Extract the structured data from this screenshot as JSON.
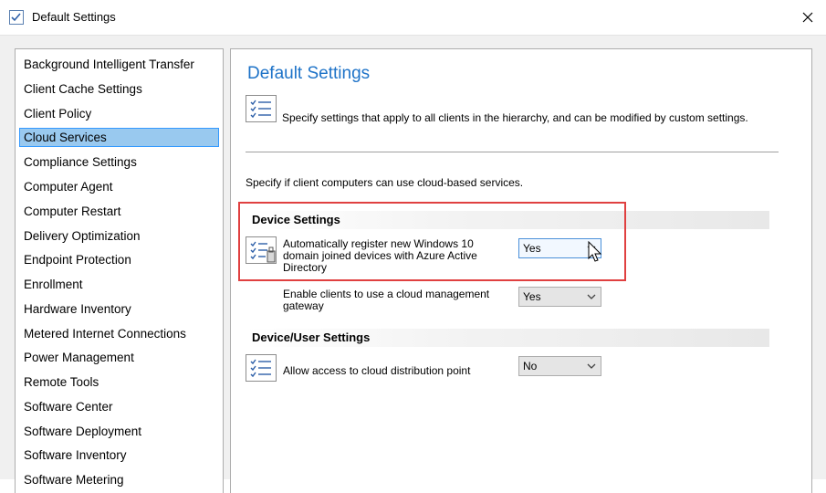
{
  "window": {
    "title": "Default Settings",
    "close_label": "✕"
  },
  "sidebar": {
    "items": [
      {
        "label": "Background Intelligent Transfer"
      },
      {
        "label": "Client Cache Settings"
      },
      {
        "label": "Client Policy"
      },
      {
        "label": "Cloud Services",
        "selected": true
      },
      {
        "label": "Compliance Settings"
      },
      {
        "label": "Computer Agent"
      },
      {
        "label": "Computer Restart"
      },
      {
        "label": "Delivery Optimization"
      },
      {
        "label": "Endpoint Protection"
      },
      {
        "label": "Enrollment"
      },
      {
        "label": "Hardware Inventory"
      },
      {
        "label": "Metered Internet Connections"
      },
      {
        "label": "Power Management"
      },
      {
        "label": "Remote Tools"
      },
      {
        "label": "Software Center"
      },
      {
        "label": "Software Deployment"
      },
      {
        "label": "Software Inventory"
      },
      {
        "label": "Software Metering"
      }
    ]
  },
  "main": {
    "title": "Default Settings",
    "description": "Specify settings that apply to all clients in the hierarchy, and can be modified by custom settings.",
    "intro": "Specify if client computers can use cloud-based services.",
    "sections": [
      {
        "title": "Device Settings",
        "settings": [
          {
            "label": "Automatically register new Windows 10 domain joined devices with Azure Active Directory",
            "value": "Yes"
          },
          {
            "label": "Enable clients to use a cloud management gateway",
            "value": "Yes"
          }
        ]
      },
      {
        "title": "Device/User Settings",
        "settings": [
          {
            "label": "Allow access to cloud distribution point",
            "value": "No"
          }
        ]
      }
    ]
  },
  "icons": {
    "title_icon": "checklist-icon",
    "settings_icon": "checklist-icon",
    "cursor": "mouse-pointer-icon"
  },
  "colors": {
    "title_blue": "#1e73c8",
    "selection": "#99c9ef",
    "highlight_red": "#e04040"
  }
}
